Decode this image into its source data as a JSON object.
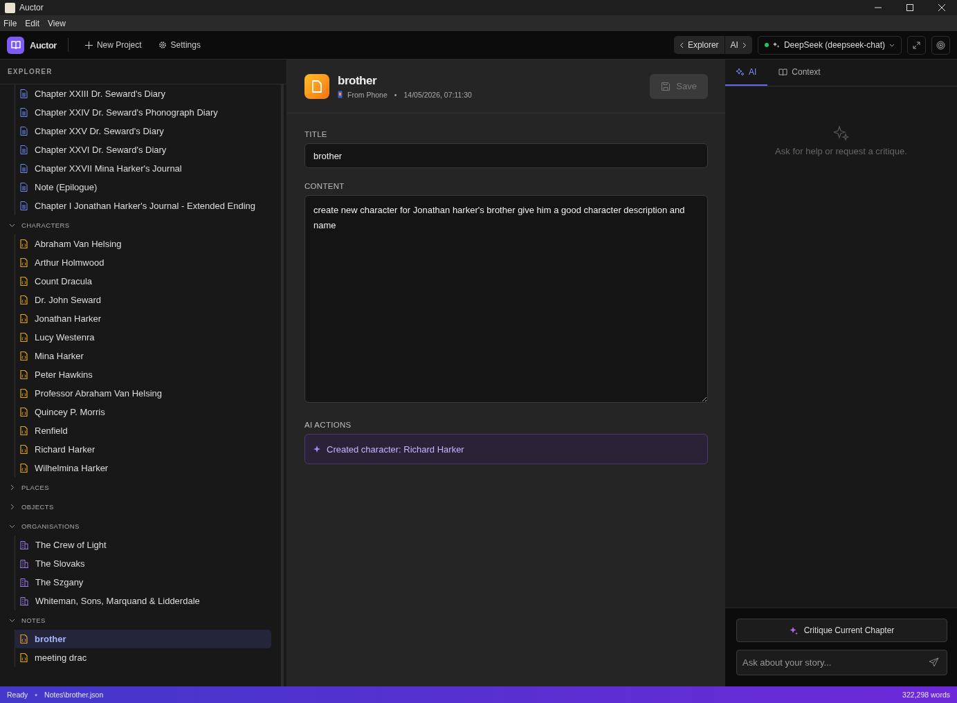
{
  "window": {
    "title": "Auctor"
  },
  "menu": [
    "File",
    "Edit",
    "View"
  ],
  "toolbar": {
    "app_name": "Auctor",
    "new_project": "New Project",
    "settings": "Settings",
    "panel_left": "Explorer",
    "panel_right": "AI",
    "model": "DeepSeek (deepseek-chat)",
    "model_online": true
  },
  "explorer": {
    "title": "EXPLORER",
    "sections": [
      {
        "kind": "chapter",
        "items": [
          {
            "label": "Chapter XXIII Dr. Seward's Diary",
            "selected": false
          },
          {
            "label": "Chapter XXIV Dr. Seward's Phonograph Diary",
            "selected": false
          },
          {
            "label": "Chapter XXV Dr. Seward's Diary",
            "selected": false
          },
          {
            "label": "Chapter XXVI Dr. Seward's Diary",
            "selected": false
          },
          {
            "label": "Chapter XXVII Mina Harker's Journal",
            "selected": false
          },
          {
            "label": "Note (Epilogue)",
            "selected": false
          },
          {
            "label": "Chapter I Jonathan Harker's Journal - Extended Ending",
            "selected": false
          }
        ]
      },
      {
        "label": "CHARACTERS",
        "kind": "character",
        "expanded": true,
        "items": [
          {
            "label": "Abraham Van Helsing",
            "selected": false
          },
          {
            "label": "Arthur Holmwood",
            "selected": false
          },
          {
            "label": "Count Dracula",
            "selected": false
          },
          {
            "label": "Dr. John Seward",
            "selected": false
          },
          {
            "label": "Jonathan Harker",
            "selected": false
          },
          {
            "label": "Lucy Westenra",
            "selected": false
          },
          {
            "label": "Mina Harker",
            "selected": false
          },
          {
            "label": "Peter Hawkins",
            "selected": false
          },
          {
            "label": "Professor Abraham Van Helsing",
            "selected": false
          },
          {
            "label": "Quincey P. Morris",
            "selected": false
          },
          {
            "label": "Renfield",
            "selected": false
          },
          {
            "label": "Richard Harker",
            "selected": false
          },
          {
            "label": "Wilhelmina Harker",
            "selected": false
          }
        ]
      },
      {
        "label": "PLACES",
        "expanded": false
      },
      {
        "label": "OBJECTS",
        "expanded": false
      },
      {
        "label": "ORGANISATIONS",
        "kind": "organisation",
        "expanded": true,
        "items": [
          {
            "label": "The Crew of Light",
            "selected": false
          },
          {
            "label": "The Slovaks",
            "selected": false
          },
          {
            "label": "The Szgany",
            "selected": false
          },
          {
            "label": "Whiteman, Sons, Marquand & Lidderdale",
            "selected": false
          }
        ]
      },
      {
        "label": "NOTES",
        "kind": "note",
        "expanded": true,
        "items": [
          {
            "label": "brother",
            "selected": true
          },
          {
            "label": "meeting drac",
            "selected": false
          }
        ]
      }
    ]
  },
  "editor": {
    "title": "brother",
    "source": "From Phone",
    "separator": "•",
    "timestamp": "14/05/2026, 07:11:30",
    "save": "Save",
    "save_disabled": true,
    "title_label": "TITLE",
    "title_value": "brother",
    "content_label": "CONTENT",
    "content_value": "create new character for Jonathan harker's brother give him a good character description and name",
    "actions_label": "AI ACTIONS",
    "actions": [
      "Created character: Richard Harker"
    ]
  },
  "ai_panel": {
    "tabs": [
      {
        "label": "AI",
        "selected": true
      },
      {
        "label": "Context",
        "selected": false
      }
    ],
    "empty_text": "Ask for help or request a critique.",
    "critique": "Critique Current Chapter",
    "placeholder": "Ask about your story..."
  },
  "status_bar": {
    "state": "Ready",
    "separator": "•",
    "path": "Notes\\brother.json",
    "words": "322,298 words"
  }
}
